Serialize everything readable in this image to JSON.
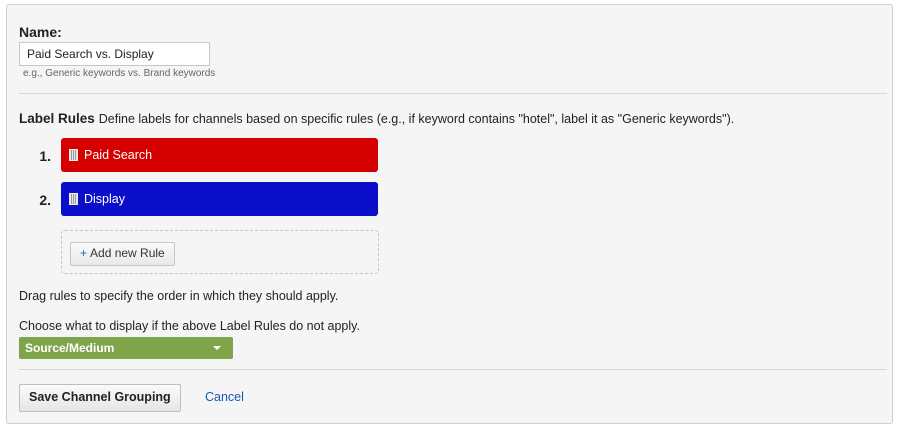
{
  "form": {
    "name_label": "Name:",
    "name_value": "Paid Search vs. Display",
    "name_hint": "e.g., Generic keywords vs. Brand keywords",
    "label_rules_title": "Label Rules",
    "label_rules_desc": "Define labels for channels based on specific rules (e.g., if keyword contains \"hotel\", label it as \"Generic keywords\").",
    "rules": [
      {
        "number": "1.",
        "label": "Paid Search",
        "color": "#d50000"
      },
      {
        "number": "2.",
        "label": "Display",
        "color": "#0b0fc9"
      }
    ],
    "add_rule_label": "Add new Rule",
    "add_rule_icon": "plus-icon",
    "drag_hint": "Drag rules to specify the order in which they should apply.",
    "fallback_prompt": "Choose what to display if the above Label Rules do not apply.",
    "fallback_value": "Source/Medium",
    "fallback_color": "#7fa54a",
    "save_label": "Save Channel Grouping",
    "cancel_label": "Cancel"
  }
}
